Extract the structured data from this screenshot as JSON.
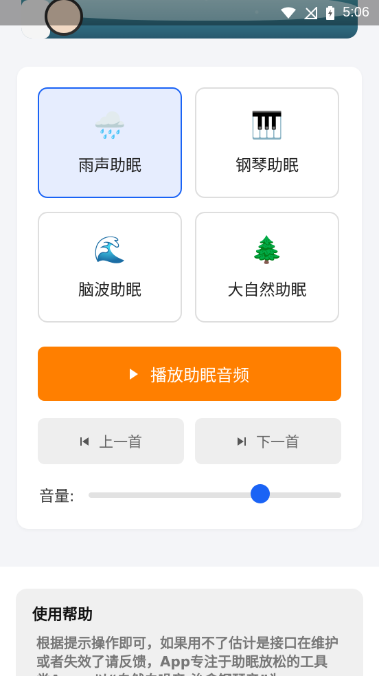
{
  "status_bar": {
    "time": "5:06",
    "wifi_icon": "wifi-icon",
    "signal_icon": "no-signal-icon",
    "battery_icon": "battery-icon"
  },
  "sound_options": [
    {
      "label": "雨声助眠",
      "icon": "rain-cloud-icon",
      "emoji": "🌧️",
      "selected": true
    },
    {
      "label": "钢琴助眠",
      "icon": "piano-icon",
      "emoji": "🎹",
      "selected": false
    },
    {
      "label": "脑波助眠",
      "icon": "wave-icon",
      "emoji": "🌊",
      "selected": false
    },
    {
      "label": "大自然助眠",
      "icon": "tree-icon",
      "emoji": "🌲",
      "selected": false
    }
  ],
  "play_button": {
    "label": "播放助眠音频",
    "icon": "play-icon"
  },
  "prev_button": {
    "label": "上一首",
    "icon": "skip-previous-icon"
  },
  "next_button": {
    "label": "下一首",
    "icon": "skip-next-icon"
  },
  "volume": {
    "label": "音量:",
    "level": 0.68
  },
  "help": {
    "title": "使用帮助",
    "text": "根据提示操作即可，如果用不了估计是接口在维护或者失效了请反馈，App专注于助眠放松的工具类App，以“自然白噪音·治愈钢琴音”为"
  },
  "colors": {
    "accent": "#1a63f5",
    "play": "#ff7f00",
    "selected_bg": "#e6edfe"
  }
}
